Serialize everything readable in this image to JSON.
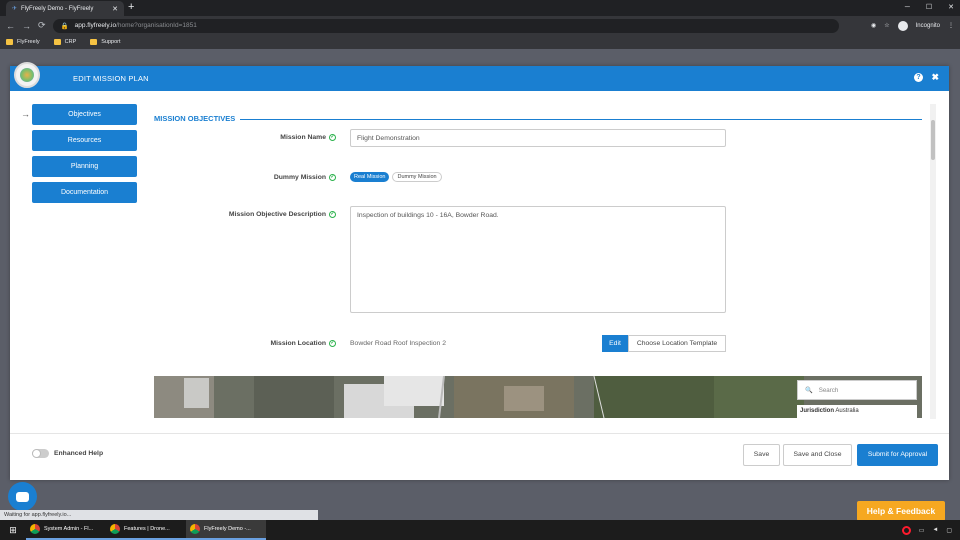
{
  "browser": {
    "tab_title": "FlyFreely Demo - FlyFreely",
    "url_host": "app.flyfreely.io",
    "url_path": "/home?organisationId=1851",
    "profile_label": "Incognito",
    "bookmarks": [
      "FlyFreely",
      "CRP",
      "Support"
    ]
  },
  "modal": {
    "title": "EDIT MISSION PLAN",
    "help_label": "?",
    "close_label": "✖"
  },
  "nav": {
    "arrow": "→",
    "items": [
      "Objectives",
      "Resources",
      "Planning",
      "Documentation"
    ]
  },
  "section": {
    "title": "MISSION OBJECTIVES"
  },
  "form": {
    "mission_name_label": "Mission Name",
    "mission_name_value": "Flight Demonstration",
    "dummy_label": "Dummy Mission",
    "dummy_options": [
      "Real Mission",
      "Dummy Mission"
    ],
    "dummy_selected": "Real Mission",
    "description_label": "Mission Objective Description",
    "description_value": "Inspection of buildings 10 - 16A, Bowder Road.",
    "location_label": "Mission Location",
    "location_value": "Bowder Road Roof Inspection 2",
    "edit_label": "Edit",
    "template_label": "Choose Location Template"
  },
  "map": {
    "search_placeholder": "Search",
    "jurisdiction_label": "Jurisdiction",
    "jurisdiction_value": "Australia"
  },
  "footer": {
    "enhanced_help_label": "Enhanced Help",
    "enhanced_help_on": false,
    "save_label": "Save",
    "save_close_label": "Save and Close",
    "submit_label": "Submit for Approval"
  },
  "page": {
    "help_feedback_label": "Help & Feedback",
    "status_text": "Waiting for app.flyfreely.io..."
  },
  "taskbar": {
    "tasks": [
      "System Admin - Fl...",
      "Features | Drone...",
      "FlyFreely Demo -..."
    ]
  },
  "colors": {
    "primary": "#1a7fd1",
    "accent": "#f6a821",
    "check": "#2bb24c"
  }
}
